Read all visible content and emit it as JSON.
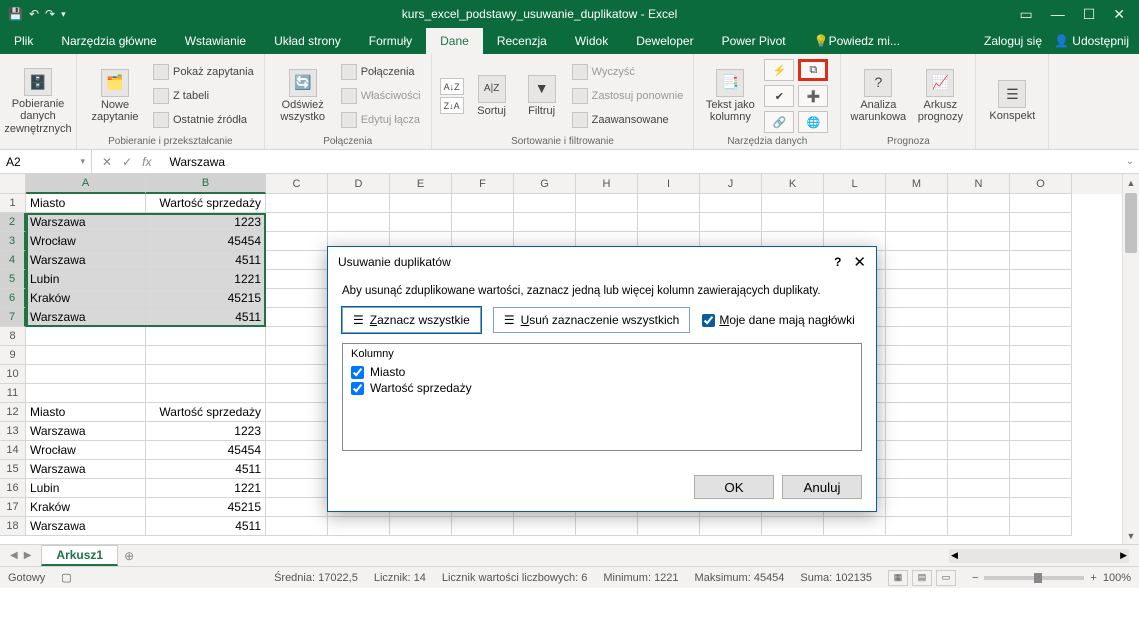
{
  "titlebar": {
    "title": "kurs_excel_podstawy_usuwanie_duplikatow - Excel"
  },
  "tabs": {
    "file": "Plik",
    "home": "Narzędzia główne",
    "insert": "Wstawianie",
    "layout": "Układ strony",
    "formulas": "Formuły",
    "data": "Dane",
    "review": "Recenzja",
    "view": "Widok",
    "developer": "Deweloper",
    "powerpivot": "Power Pivot",
    "tellme": "Powiedz mi...",
    "signin": "Zaloguj się",
    "share": "Udostępnij"
  },
  "ribbon": {
    "ext_data": {
      "big": "Pobieranie danych\nzewnętrznych"
    },
    "transform": {
      "big": "Nowe\nzapytanie",
      "show": "Pokaż zapytania",
      "table": "Z tabeli",
      "recent": "Ostatnie źródła",
      "group_label": "Pobieranie i przekształcanie"
    },
    "connections": {
      "big": "Odśwież\nwszystko",
      "conn": "Połączenia",
      "prop": "Właściwości",
      "edit": "Edytuj łącza",
      "group_label": "Połączenia"
    },
    "sort": {
      "sort": "Sortuj",
      "filter": "Filtruj",
      "clear": "Wyczyść",
      "reapply": "Zastosuj ponownie",
      "advanced": "Zaawansowane",
      "group_label": "Sortowanie i filtrowanie"
    },
    "tools": {
      "text_cols": "Tekst jako\nkolumny",
      "group_label": "Narzędzia danych"
    },
    "forecast": {
      "whatif": "Analiza\nwarunkowa",
      "sheet": "Arkusz\nprognozy",
      "group_label": "Prognoza"
    },
    "outline": {
      "big": "Konspekt"
    }
  },
  "fbar": {
    "name": "A2",
    "formula": "Warszawa"
  },
  "cols": [
    "A",
    "B",
    "C",
    "D",
    "E",
    "F",
    "G",
    "H",
    "I",
    "J",
    "K",
    "L",
    "M",
    "N",
    "O"
  ],
  "header_row": {
    "a": "Miasto",
    "b": "Wartość sprzedaży"
  },
  "data1": [
    {
      "a": "Warszawa",
      "b": "1223"
    },
    {
      "a": "Wrocław",
      "b": "45454"
    },
    {
      "a": "Warszawa",
      "b": "4511"
    },
    {
      "a": "Lubin",
      "b": "1221"
    },
    {
      "a": "Kraków",
      "b": "45215"
    },
    {
      "a": "Warszawa",
      "b": "4511"
    }
  ],
  "header_row2": {
    "a": "Miasto",
    "b": "Wartość sprzedaży"
  },
  "data2": [
    {
      "a": "Warszawa",
      "b": "1223"
    },
    {
      "a": "Wrocław",
      "b": "45454"
    },
    {
      "a": "Warszawa",
      "b": "4511"
    },
    {
      "a": "Lubin",
      "b": "1221"
    },
    {
      "a": "Kraków",
      "b": "45215"
    },
    {
      "a": "Warszawa",
      "b": "4511"
    }
  ],
  "sheet": {
    "name": "Arkusz1"
  },
  "statusbar": {
    "ready": "Gotowy",
    "avg": "Średnia: 17022,5",
    "count": "Licznik: 14",
    "numcount": "Licznik wartości liczbowych: 6",
    "min": "Minimum: 1221",
    "max": "Maksimum: 45454",
    "sum": "Suma: 102135",
    "zoom": "100%"
  },
  "dialog": {
    "title": "Usuwanie duplikatów",
    "instr": "Aby usunąć zduplikowane wartości, zaznacz jedną lub więcej kolumn zawierających duplikaty.",
    "select_all_pre": "Z",
    "select_all_rest": "aznacz wszystkie",
    "unselect_pre": "U",
    "unselect_rest": "suń zaznaczenie wszystkich",
    "headers_pre": "M",
    "headers_rest": "oje dane mają nagłówki",
    "cols_label": "Kolumny",
    "col1": "Miasto",
    "col2": "Wartość sprzedaży",
    "ok": "OK",
    "cancel": "Anuluj"
  }
}
